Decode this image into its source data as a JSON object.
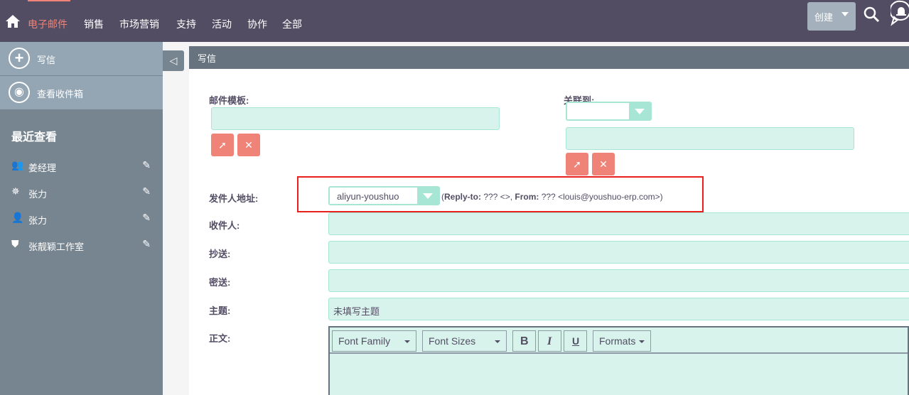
{
  "nav": {
    "items": [
      "电子邮件",
      "销售",
      "市场营销",
      "支持",
      "活动",
      "协作",
      "全部"
    ],
    "active": "电子邮件",
    "create_label": "创建"
  },
  "sidebar": {
    "actions": [
      {
        "label": "写信",
        "icon": "plus-circle-icon"
      },
      {
        "label": "查看收件箱",
        "icon": "eye-icon"
      }
    ],
    "recent_title": "最近查看",
    "recent": [
      {
        "label": "姜经理",
        "icon": "users-icon"
      },
      {
        "label": "张力",
        "icon": "badge-icon"
      },
      {
        "label": "张力",
        "icon": "user-icon"
      },
      {
        "label": "张靓颖工作室",
        "icon": "shield-icon"
      }
    ]
  },
  "panel": {
    "title": "写信"
  },
  "form": {
    "template_label": "邮件模板:",
    "related_label": "关联到:",
    "from_label": "发件人地址:",
    "from_value": "aliyun-youshuo",
    "from_info_replyto_label": "Reply-to:",
    "from_info_replyto": " ??? <>, ",
    "from_info_from_label": "From:",
    "from_info_from": " ??? <louis@youshuo-erp.com>)",
    "to_label": "收件人:",
    "cc_label": "抄送:",
    "bcc_label": "密送:",
    "subject_label": "主题:",
    "subject_value": "未填写主题",
    "body_label": "正文:"
  },
  "editor": {
    "font_family": "Font Family",
    "font_sizes": "Font Sizes",
    "bold": "B",
    "italic": "I",
    "underline": "U",
    "formats": "Formats"
  },
  "colors": {
    "topbar": "#534d64",
    "accent": "#f08377",
    "sidebar": "#778590",
    "field": "#d8f3ec",
    "highlight": "#e8211d"
  }
}
